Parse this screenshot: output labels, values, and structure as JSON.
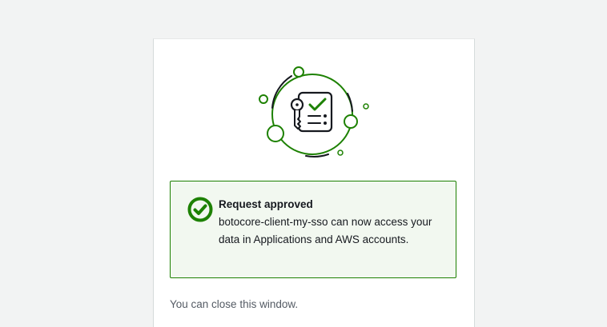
{
  "illustration": {
    "icon": "sso-authorization-illustration",
    "accent_color": "#1d8102",
    "line_color": "#16191f"
  },
  "alert": {
    "status": "success",
    "icon": "check-circle-icon",
    "title": "Request approved",
    "message": "botocore-client-my-sso can now access your data in Applications and AWS accounts.",
    "border_color": "#1d8102",
    "background_color": "#f2f8f0"
  },
  "footer": {
    "note": "You can close this window."
  }
}
